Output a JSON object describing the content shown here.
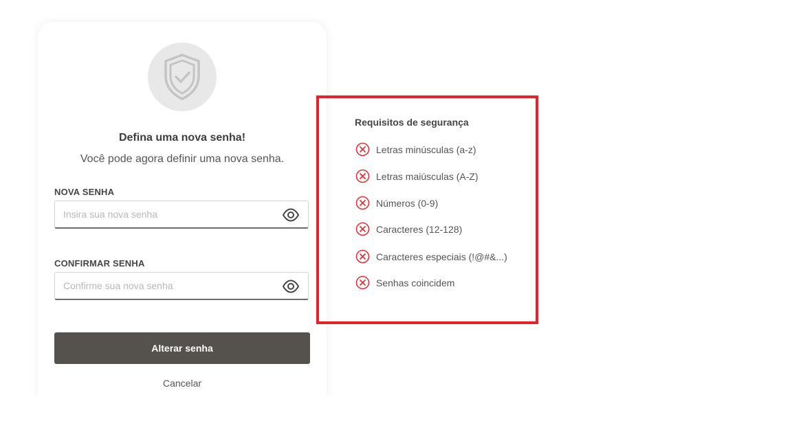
{
  "card": {
    "title": "Defina uma nova senha!",
    "subtitle": "Você pode agora definir uma nova senha.",
    "icon": "shield-check-icon",
    "new_password": {
      "label": "NOVA SENHA",
      "placeholder": "Insira sua nova senha",
      "value": ""
    },
    "confirm_password": {
      "label": "CONFIRMAR SENHA",
      "placeholder": "Confirme sua nova senha",
      "value": ""
    },
    "submit_label": "Alterar senha",
    "cancel_label": "Cancelar"
  },
  "requirements": {
    "title": "Requisitos de segurança",
    "items": [
      {
        "label": "Letras minúsculas (a-z)",
        "met": false
      },
      {
        "label": "Letras maiúsculas (A-Z)",
        "met": false
      },
      {
        "label": "Números (0-9)",
        "met": false
      },
      {
        "label": "Caracteres (12-128)",
        "met": false
      },
      {
        "label": "Caracteres especiais (!@#&...)",
        "met": false
      },
      {
        "label": "Senhas coincidem",
        "met": false
      }
    ]
  },
  "colors": {
    "button_bg": "#55514c",
    "highlight_border": "#e8202a",
    "error_icon": "#e2333a"
  }
}
